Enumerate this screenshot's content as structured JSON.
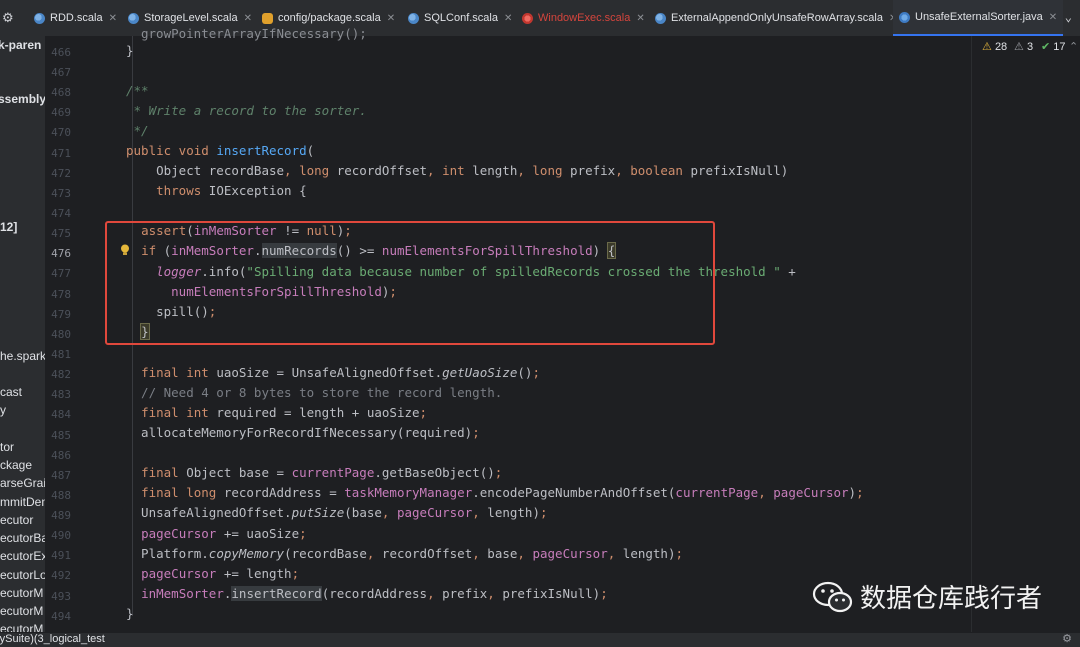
{
  "tabs": [
    {
      "label": "RDD.scala",
      "icon": "scala-file-icon",
      "active": false
    },
    {
      "label": "StorageLevel.scala",
      "icon": "scala-file-icon",
      "active": false
    },
    {
      "label": "config/package.scala",
      "icon": "package-file-icon",
      "active": false
    },
    {
      "label": "SQLConf.scala",
      "icon": "scala-file-icon",
      "active": false
    },
    {
      "label": "WindowExec.scala",
      "icon": "scala-file-icon",
      "active": false,
      "color": "#d4453d"
    },
    {
      "label": "ExternalAppendOnlyUnsafeRowArray.scala",
      "icon": "scala-file-icon",
      "active": false
    },
    {
      "label": "UnsafeExternalSorter.java",
      "icon": "java-file-icon",
      "active": true
    }
  ],
  "project_panel": [
    "k-paren",
    "ssembly_",
    "12]",
    "he.spark",
    "cast",
    "y",
    "tor",
    "ckage",
    "arseGrai",
    "mmitDen",
    "ecutor",
    "ecutorBa",
    "ecutorEx",
    "ecutorLo",
    "ecutorM",
    "ecutorM",
    "ecutorM"
  ],
  "inspections": {
    "warnings": "28",
    "weak_warnings": "3",
    "typos": "17"
  },
  "bottom_status": "rySuite)(3_logical_test",
  "code_lines": [
    {
      "n": "466",
      "text": "}"
    },
    {
      "n": "467",
      "text": ""
    },
    {
      "n": "468",
      "text": "/**"
    },
    {
      "n": "469",
      "text": " * Write a record to the sorter."
    },
    {
      "n": "470",
      "text": " */"
    },
    {
      "n": "471",
      "text": "public void insertRecord("
    },
    {
      "n": "472",
      "text": "    Object recordBase, long recordOffset, int length, long prefix, boolean prefixIsNull)"
    },
    {
      "n": "473",
      "text": "    throws IOException {"
    },
    {
      "n": "474",
      "text": ""
    },
    {
      "n": "475",
      "text": "  assert(inMemSorter != null);"
    },
    {
      "n": "476",
      "text": "  if (inMemSorter.numRecords() >= numElementsForSpillThreshold) {"
    },
    {
      "n": "477",
      "text": "    logger.info(\"Spilling data because number of spilledRecords crossed the threshold \" +"
    },
    {
      "n": "478",
      "text": "      numElementsForSpillThreshold);"
    },
    {
      "n": "479",
      "text": "    spill();"
    },
    {
      "n": "480",
      "text": "  }"
    },
    {
      "n": "481",
      "text": ""
    },
    {
      "n": "482",
      "text": "  final int uaoSize = UnsafeAlignedOffset.getUaoSize();"
    },
    {
      "n": "483",
      "text": "  // Need 4 or 8 bytes to store the record length."
    },
    {
      "n": "484",
      "text": "  final int required = length + uaoSize;"
    },
    {
      "n": "485",
      "text": "  allocateMemoryForRecordIfNecessary(required);"
    },
    {
      "n": "486",
      "text": ""
    },
    {
      "n": "487",
      "text": "  final Object base = currentPage.getBaseObject();"
    },
    {
      "n": "488",
      "text": "  final long recordAddress = taskMemoryManager.encodePageNumberAndOffset(currentPage, pageCursor);"
    },
    {
      "n": "489",
      "text": "  UnsafeAlignedOffset.putSize(base, pageCursor, length);"
    },
    {
      "n": "490",
      "text": "  pageCursor += uaoSize;"
    },
    {
      "n": "491",
      "text": "  Platform.copyMemory(recordBase, recordOffset, base, pageCursor, length);"
    },
    {
      "n": "492",
      "text": "  pageCursor += length;"
    },
    {
      "n": "493",
      "text": "  inMemSorter.insertRecord(recordAddress, prefix, prefixIsNull);"
    },
    {
      "n": "494",
      "text": "}"
    }
  ],
  "top_partial_line": "growPointerArrayIfNecessary();",
  "current_line": "476",
  "watermark": "数据仓库践行者",
  "colors": {
    "highlight_box": "#e0483c",
    "keyword": "#cf8e6d",
    "field": "#c77dbb",
    "string": "#6aab73",
    "method": "#56a8f5"
  }
}
